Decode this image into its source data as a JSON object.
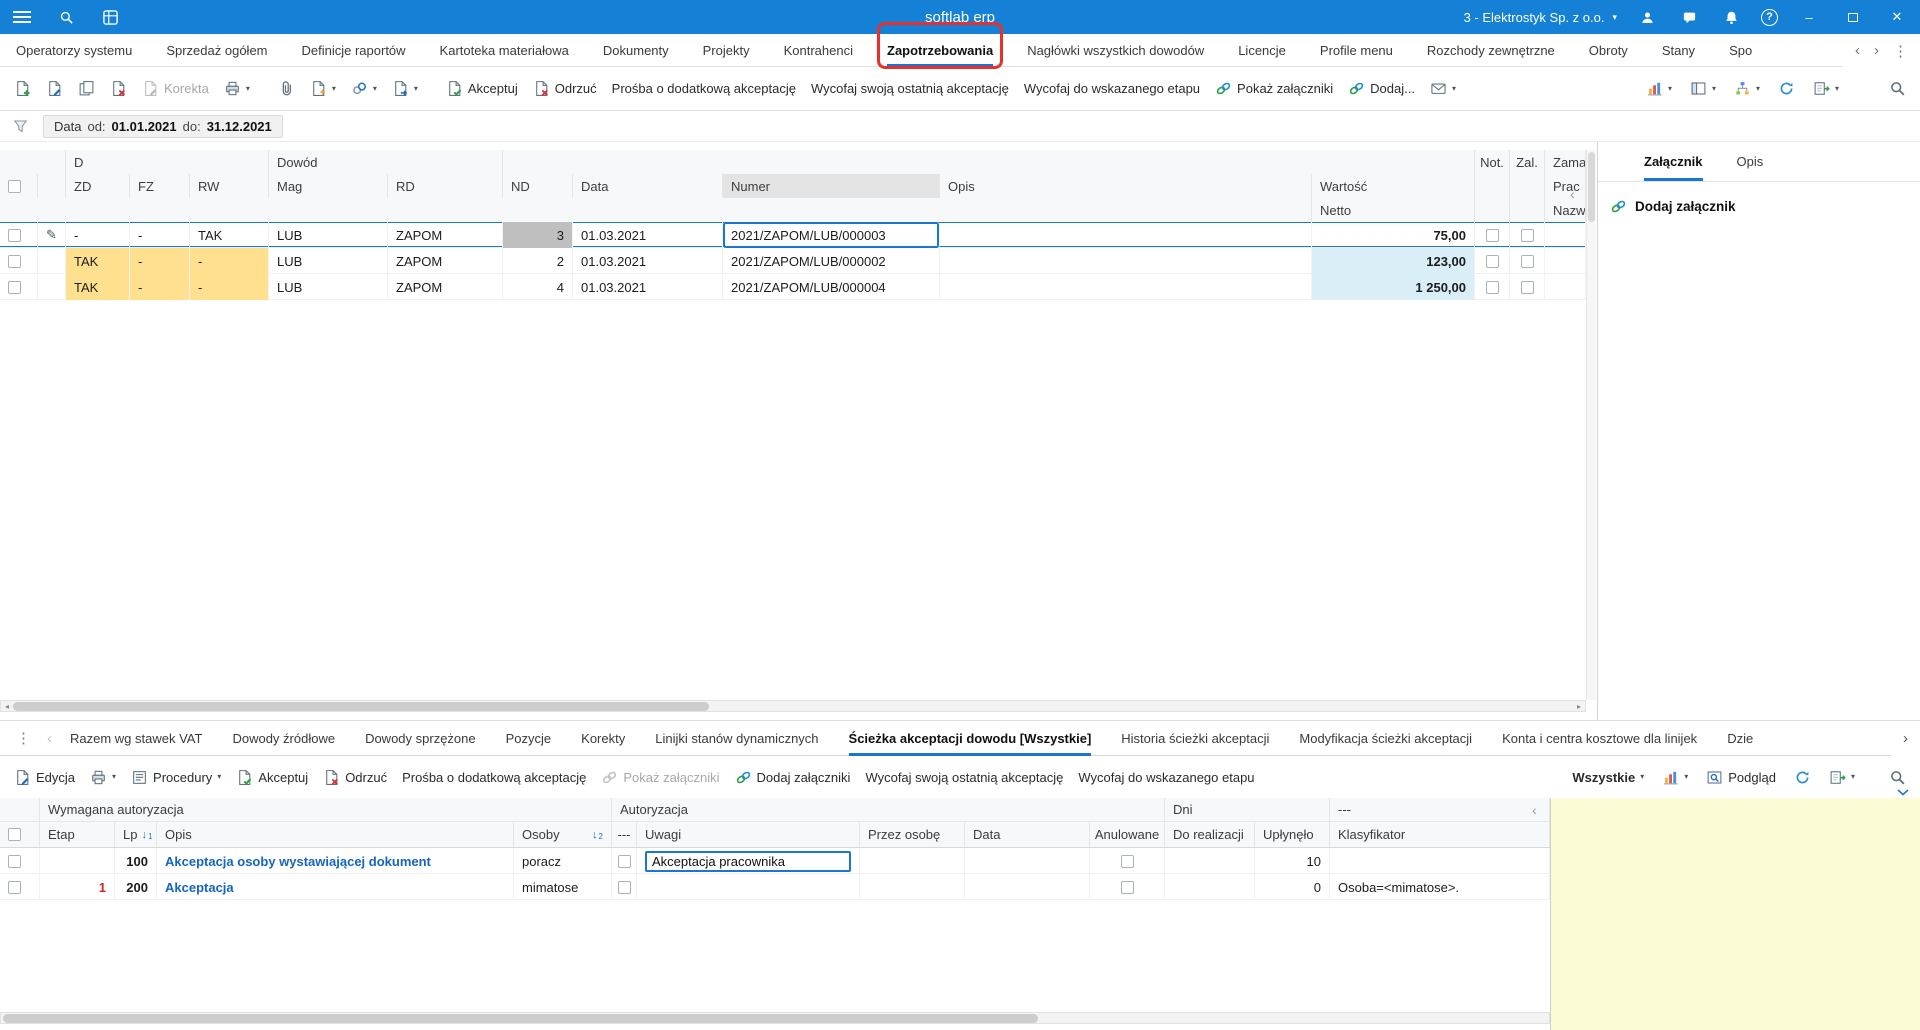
{
  "colors": {
    "topbar": "#1481d6",
    "accent": "#1976d2",
    "annotation": "#e8312e",
    "yellow_cell": "#ffe08f",
    "blue_cell": "#d9eef7",
    "note_panel": "#fbfbd5"
  },
  "glyphs": {
    "caret": "▾",
    "chevron_left": "‹",
    "chevron_right": "›",
    "dots": "⋮",
    "pencil": "✎",
    "minimize": "–",
    "close": "✕",
    "help": "?",
    "sort_arrow": "↓",
    "scroll_left": "◂",
    "scroll_right": "▸"
  },
  "topbar": {
    "title": "softlab erp",
    "company": "3 - Elektrostyk Sp. z o.o."
  },
  "menubar": {
    "items": [
      "Operatorzy systemu",
      "Sprzedaż ogółem",
      "Definicje raportów",
      "Kartoteka materiałowa",
      "Dokumenty",
      "Projekty",
      "Kontrahenci",
      "Zapotrzebowania",
      "Nagłówki wszystkich dowodów",
      "Licencje",
      "Profile menu",
      "Rozchody zewnętrzne",
      "Obroty",
      "Stany",
      "Spo"
    ],
    "active": "Zapotrzebowania"
  },
  "toolbar": {
    "korekta": "Korekta",
    "akceptuj": "Akceptuj",
    "odrzuc": "Odrzuć",
    "prosba": "Prośba o dodatkową akceptację",
    "wycofaj_ostatnia": "Wycofaj swoją ostatnią akceptację",
    "wycofaj_etap": "Wycofaj do wskazanego etapu",
    "pokaz_zalaczniki": "Pokaż załączniki",
    "dodaj": "Dodaj..."
  },
  "filterbar": {
    "label": "Data",
    "od_label": "od:",
    "od_value": "01.01.2021",
    "do_label": "do:",
    "do_value": "31.12.2021"
  },
  "main_table": {
    "groups": {
      "d": "D",
      "dowod": "Dowód",
      "not": "Not.",
      "zal": "Zal.",
      "zama": "Zama"
    },
    "headers": {
      "zd": "ZD",
      "fz": "FZ",
      "rw": "RW",
      "mag": "Mag",
      "rd": "RD",
      "nd": "ND",
      "data": "Data",
      "numer": "Numer",
      "opis": "Opis",
      "wartosc": "Wartość",
      "netto": "Netto",
      "prac": "Prac",
      "nazw": "Nazw"
    },
    "rows": [
      {
        "zd": "-",
        "fz": "-",
        "rw": "TAK",
        "mag": "LUB",
        "rd": "ZAPOM",
        "nd": "3",
        "data": "01.03.2021",
        "numer": "2021/ZAPOM/LUB/000003",
        "opis": "",
        "netto": "75,00",
        "selected": true,
        "yellow": false
      },
      {
        "zd": "TAK",
        "fz": "-",
        "rw": "-",
        "mag": "LUB",
        "rd": "ZAPOM",
        "nd": "2",
        "data": "01.03.2021",
        "numer": "2021/ZAPOM/LUB/000002",
        "opis": "",
        "netto": "123,00",
        "selected": false,
        "yellow": true
      },
      {
        "zd": "TAK",
        "fz": "-",
        "rw": "-",
        "mag": "LUB",
        "rd": "ZAPOM",
        "nd": "4",
        "data": "01.03.2021",
        "numer": "2021/ZAPOM/LUB/000004",
        "opis": "",
        "netto": "1 250,00",
        "selected": false,
        "yellow": true
      }
    ]
  },
  "attachments_panel": {
    "tabs": [
      "Załącznik",
      "Opis"
    ],
    "active": "Załącznik",
    "add_label": "Dodaj załącznik"
  },
  "bottom_tabs": {
    "items": [
      "Razem wg stawek VAT",
      "Dowody źródłowe",
      "Dowody sprzężone",
      "Pozycje",
      "Korekty",
      "Linijki stanów dynamicznych",
      "Ścieżka akceptacji dowodu [Wszystkie]",
      "Historia ścieżki akceptacji",
      "Modyfikacja ścieżki akceptacji",
      "Konta i centra kosztowe dla linijek",
      "Dzie"
    ],
    "active": "Ścieżka akceptacji dowodu [Wszystkie]"
  },
  "bottom_toolbar": {
    "edycja": "Edycja",
    "procedury": "Procedury",
    "akceptuj": "Akceptuj",
    "odrzuc": "Odrzuć",
    "prosba": "Prośba o dodatkową akceptację",
    "pokaz": "Pokaż załączniki",
    "dodaj": "Dodaj załączniki",
    "wycofaj_ostatnia": "Wycofaj swoją ostatnią akceptację",
    "wycofaj_etap": "Wycofaj do wskazanego etapu",
    "wszystkie": "Wszystkie",
    "podglad": "Podgląd"
  },
  "approval_table": {
    "groups": {
      "wymagana": "Wymagana autoryzacja",
      "autoryzacja": "Autoryzacja",
      "dni": "Dni",
      "dash": "---"
    },
    "headers": {
      "etap": "Etap",
      "lp": "Lp",
      "lp_sort": "1",
      "opis": "Opis",
      "osoby": "Osoby",
      "osoby_sort": "2",
      "dash": "---",
      "uwagi": "Uwagi",
      "przez": "Przez osobę",
      "data": "Data",
      "anulowane": "Anulowane",
      "do_realizacji": "Do realizacji",
      "uplynelo": "Upłynęło",
      "klasyfikator": "Klasyfikator"
    },
    "rows": [
      {
        "etap": "",
        "lp": "100",
        "opis": "Akceptacja osoby wystawiającej dokument",
        "osoby": "poracz",
        "uwagi": "Akceptacja pracownika",
        "uwagi_editing": true,
        "przez": "",
        "data": "",
        "do_realizacji": "",
        "uplynelo": "10",
        "klasyfikator": ""
      },
      {
        "etap": "1",
        "lp": "200",
        "opis": "Akceptacja",
        "osoby": "mimatose",
        "uwagi": "",
        "uwagi_editing": false,
        "przez": "",
        "data": "",
        "do_realizacji": "",
        "uplynelo": "0",
        "klasyfikator": "Osoba=<mimatose>."
      }
    ]
  }
}
